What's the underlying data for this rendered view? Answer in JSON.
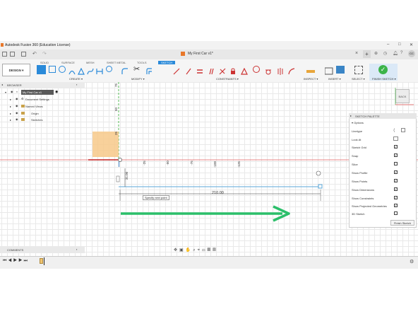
{
  "window": {
    "title": "Autodesk Fusion 360 (Education License)",
    "doc_tab": "My First Car v1*"
  },
  "ribbon": {
    "tabs": [
      "SOLID",
      "SURFACE",
      "MESH",
      "SHEET METAL",
      "TOOLS",
      "SKETCH"
    ],
    "active_tab": "SKETCH",
    "design_label": "DESIGN",
    "groups": {
      "create": "CREATE",
      "modify": "MODIFY",
      "constraints": "CONSTRAINTS",
      "inspect": "INSPECT",
      "insert": "INSERT",
      "select": "SELECT",
      "finish": "FINISH SKETCH"
    }
  },
  "browser": {
    "title": "BROWSER",
    "root": "My First Car v1",
    "items": [
      "Document Settings",
      "Named Views",
      "Origin",
      "Sketches"
    ]
  },
  "viewcube": {
    "label": "BACK"
  },
  "palette": {
    "title": "SKETCH PALETTE",
    "section": "Options",
    "rows": [
      {
        "label": "Linetype",
        "checked": null
      },
      {
        "label": "Look At",
        "checked": null
      },
      {
        "label": "Sketch Grid",
        "checked": true
      },
      {
        "label": "Snap",
        "checked": true
      },
      {
        "label": "Slice",
        "checked": false
      },
      {
        "label": "Show Profile",
        "checked": true
      },
      {
        "label": "Show Points",
        "checked": true
      },
      {
        "label": "Show Dimensions",
        "checked": true
      },
      {
        "label": "Show Constraints",
        "checked": true
      },
      {
        "label": "Show Projected Geometries",
        "checked": true
      },
      {
        "label": "3D Sketch",
        "checked": false
      }
    ],
    "finish_button": "Finish Sketch"
  },
  "canvas": {
    "dimension_width": "210.00",
    "dimension_height": "31.00",
    "tooltip": "Specify next point",
    "ruler_v": [
      "75",
      "50",
      "25"
    ],
    "ruler_h": [
      "-25",
      "-50",
      "-75",
      "-100",
      "-125"
    ]
  },
  "comments": {
    "title": "COMMENTS"
  },
  "colors": {
    "accent": "#2a8ad9",
    "arrow": "#2bbf6a",
    "sketch_line": "#5aa7d8",
    "finish_green": "#3cb44a"
  }
}
